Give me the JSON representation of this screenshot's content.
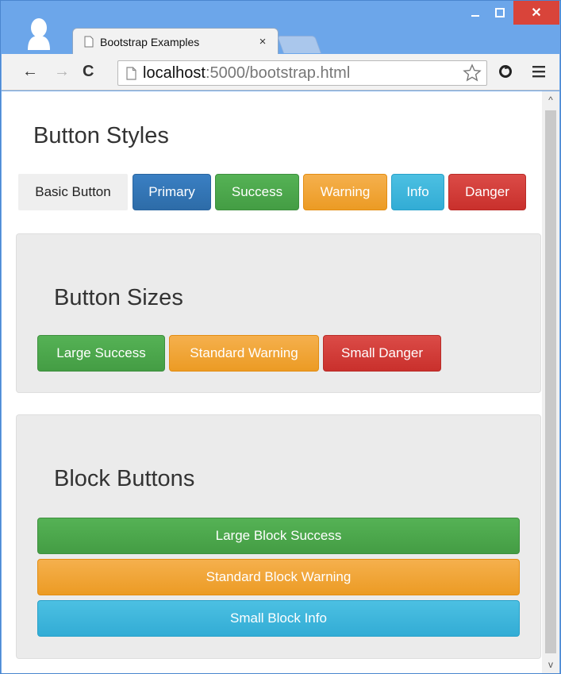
{
  "window": {
    "tab_title": "Bootstrap Examples",
    "tab_close": "×",
    "min_glyph": "‒",
    "max_glyph": "☐",
    "close_glyph": "✕"
  },
  "toolbar": {
    "back_glyph": "←",
    "forward_glyph": "→",
    "reload_glyph": "C",
    "url_host": "localhost",
    "url_rest": ":5000/bootstrap.html"
  },
  "scrollbar": {
    "up_glyph": "^",
    "down_glyph": "v"
  },
  "page": {
    "button_styles": {
      "title": "Button Styles",
      "buttons": [
        "Basic Button",
        "Primary",
        "Success",
        "Warning",
        "Info",
        "Danger"
      ]
    },
    "button_sizes": {
      "title": "Button Sizes",
      "buttons": [
        "Large Success",
        "Standard Warning",
        "Small Danger"
      ]
    },
    "block_buttons": {
      "title": "Block Buttons",
      "buttons": [
        "Large Block Success",
        "Standard Block Warning",
        "Small Block Info"
      ]
    }
  },
  "colors": {
    "primary": "#337ab7",
    "success": "#4cae4c",
    "warning": "#f0ad4e",
    "info": "#46b8da",
    "danger": "#d9534f",
    "window_frame": "#6ca6ea",
    "close_button": "#d9443a"
  },
  "icons": {
    "profile": "person-silhouette-icon",
    "favicon": "page-icon",
    "bookmark": "star-icon",
    "extension": "sync-icon",
    "menu": "hamburger-menu-icon"
  }
}
